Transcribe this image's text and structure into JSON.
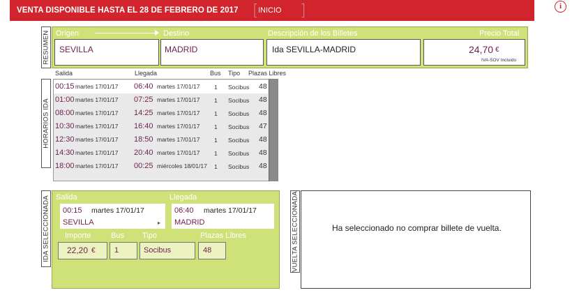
{
  "header": {
    "title": "VENTA DISPONIBLE HASTA EL 28 DE FEBRERO DE 2017",
    "inicio_label": "INICIO",
    "info_label": "i"
  },
  "resumen": {
    "tab_label": "RESUMEN",
    "origen_label": "Origen",
    "destino_label": "Destino",
    "descripcion_label": "Descripción de los Billetes",
    "precio_label": "Precio Total",
    "origen": "SEVILLA",
    "destino": "MADRID",
    "descripcion": "Ida SEVILLA-MADRID",
    "precio": "24,70",
    "currency": "€",
    "iva": "IVA-SOV Incluido"
  },
  "horarios": {
    "tab_label": "HORARIOS IDA",
    "columns": {
      "salida": "Salida",
      "llegada": "Llegada",
      "bus": "Bus",
      "tipo": "Tipo",
      "plazas": "Plazas Libres"
    },
    "rows": [
      {
        "salida_time": "00:15",
        "salida_date": "martes 17/01/17",
        "llegada_time": "06:40",
        "llegada_date": "martes 17/01/17",
        "bus": "1",
        "tipo": "Socibus",
        "plazas": "48"
      },
      {
        "salida_time": "01:00",
        "salida_date": "martes 17/01/17",
        "llegada_time": "07:25",
        "llegada_date": "martes 17/01/17",
        "bus": "1",
        "tipo": "Socibus",
        "plazas": "48"
      },
      {
        "salida_time": "08:00",
        "salida_date": "martes 17/01/17",
        "llegada_time": "14:25",
        "llegada_date": "martes 17/01/17",
        "bus": "1",
        "tipo": "Socibus",
        "plazas": "48"
      },
      {
        "salida_time": "10:30",
        "salida_date": "martes 17/01/17",
        "llegada_time": "16:40",
        "llegada_date": "martes 17/01/17",
        "bus": "1",
        "tipo": "Socibus",
        "plazas": "47"
      },
      {
        "salida_time": "12:30",
        "salida_date": "martes 17/01/17",
        "llegada_time": "18:50",
        "llegada_date": "martes 17/01/17",
        "bus": "1",
        "tipo": "Socibus",
        "plazas": "48"
      },
      {
        "salida_time": "14:30",
        "salida_date": "martes 17/01/17",
        "llegada_time": "20:40",
        "llegada_date": "martes 17/01/17",
        "bus": "1",
        "tipo": "Socibus",
        "plazas": "48"
      },
      {
        "salida_time": "18:00",
        "salida_date": "martes 17/01/17",
        "llegada_time": "00:25",
        "llegada_date": "miércoles 18/01/17",
        "bus": "1",
        "tipo": "Socibus",
        "plazas": "48"
      }
    ]
  },
  "ida_seleccionada": {
    "tab_label": "IDA  SELECCIONADA",
    "salida_label": "Salida",
    "llegada_label": "Llegada",
    "salida_time": "00:15",
    "salida_date": "martes 17/01/17",
    "salida_city": "SEVILLA",
    "llegada_time": "06:40",
    "llegada_date": "martes 17/01/17",
    "llegada_city": "MADRID",
    "importe_label": "Importe",
    "bus_label": "Bus",
    "tipo_label": "Tipo",
    "plazas_label": "Plazas Libres",
    "importe": "22,20",
    "currency": "€",
    "bus": "1",
    "tipo": "Socibus",
    "plazas": "48"
  },
  "vuelta_seleccionada": {
    "tab_label": "VUELTA SELECCIONADA",
    "message": "Ha seleccionado no comprar billete de vuelta."
  },
  "colors": {
    "header_red": "#d1242c",
    "panel_green": "#cfe27a",
    "value_purple": "#6d1f4d"
  }
}
